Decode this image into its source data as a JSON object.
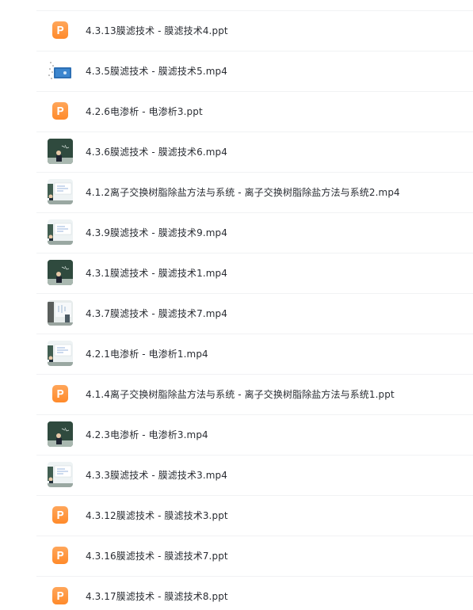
{
  "files": [
    {
      "name": "4.3.13膜滤技术 - 膜滤技术4.ppt",
      "type": "ppt",
      "icon": "ppt-file-icon"
    },
    {
      "name": "4.3.5膜滤技术 - 膜滤技术5.mp4",
      "type": "video-dots",
      "icon": "video-thumbnail-icon"
    },
    {
      "name": "4.2.6电渗析 - 电渗析3.ppt",
      "type": "ppt",
      "icon": "ppt-file-icon"
    },
    {
      "name": "4.3.6膜滤技术 - 膜滤技术6.mp4",
      "type": "video-dark",
      "icon": "video-thumbnail-icon"
    },
    {
      "name": "4.1.2离子交换树脂除盐方法与系统 - 离子交换树脂除盐方法与系统2.mp4",
      "type": "video-light",
      "icon": "video-thumbnail-icon"
    },
    {
      "name": "4.3.9膜滤技术 - 膜滤技术9.mp4",
      "type": "video-light",
      "icon": "video-thumbnail-icon"
    },
    {
      "name": "4.3.1膜滤技术 - 膜滤技术1.mp4",
      "type": "video-dark",
      "icon": "video-thumbnail-icon"
    },
    {
      "name": "4.3.7膜滤技术 - 膜滤技术7.mp4",
      "type": "video-split",
      "icon": "video-thumbnail-icon"
    },
    {
      "name": "4.2.1电渗析 - 电渗析1.mp4",
      "type": "video-light",
      "icon": "video-thumbnail-icon"
    },
    {
      "name": "4.1.4离子交换树脂除盐方法与系统 - 离子交换树脂除盐方法与系统1.ppt",
      "type": "ppt",
      "icon": "ppt-file-icon"
    },
    {
      "name": "4.2.3电渗析 - 电渗析3.mp4",
      "type": "video-dark",
      "icon": "video-thumbnail-icon"
    },
    {
      "name": "4.3.3膜滤技术 - 膜滤技术3.mp4",
      "type": "video-light",
      "icon": "video-thumbnail-icon"
    },
    {
      "name": "4.3.12膜滤技术 - 膜滤技术3.ppt",
      "type": "ppt",
      "icon": "ppt-file-icon"
    },
    {
      "name": "4.3.16膜滤技术 - 膜滤技术7.ppt",
      "type": "ppt",
      "icon": "ppt-file-icon"
    },
    {
      "name": "4.3.17膜滤技术 - 膜滤技术8.ppt",
      "type": "ppt",
      "icon": "ppt-file-icon"
    }
  ]
}
